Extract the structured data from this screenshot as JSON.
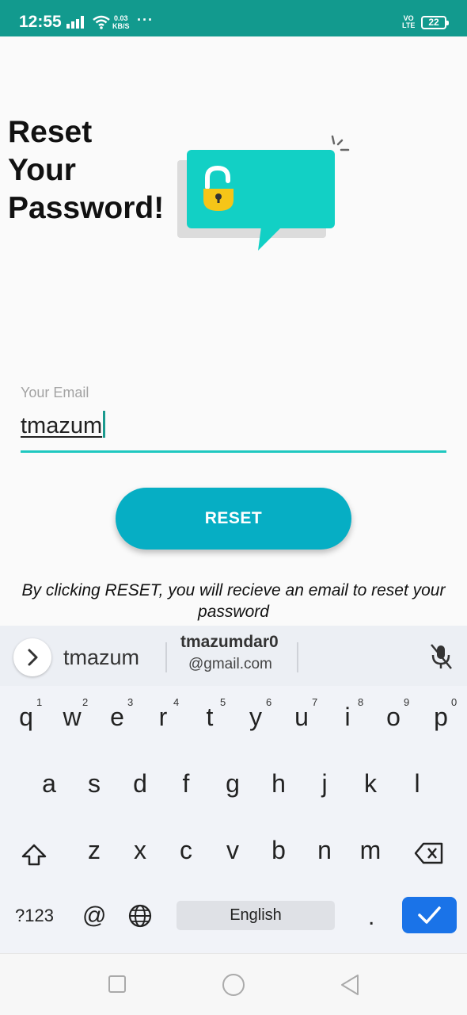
{
  "status_bar": {
    "time": "12:55",
    "net_speed_value": "0.03",
    "net_speed_unit": "KB/S",
    "more": "···",
    "volte_top": "VO",
    "volte_bottom": "LTE",
    "battery": "22",
    "background_color": "#129a8e"
  },
  "page": {
    "title_line1": "Reset",
    "title_line2": "Your",
    "title_line3": "Password!",
    "illustration_icon": "unlocked-padlock-speech-bubble",
    "accent_color": "#12d0c5"
  },
  "email_field": {
    "label": "Your Email",
    "value": "tmazum"
  },
  "reset_button": {
    "label": "RESET",
    "color": "#06aec4"
  },
  "info_text": "By clicking RESET, you will recieve an email to reset your password",
  "keyboard": {
    "suggestions": {
      "first": "tmazum",
      "second_line1": "tmazumdar0",
      "second_line2": "@gmail.com"
    },
    "row1": [
      {
        "k": "q",
        "h": "1"
      },
      {
        "k": "w",
        "h": "2"
      },
      {
        "k": "e",
        "h": "3"
      },
      {
        "k": "r",
        "h": "4"
      },
      {
        "k": "t",
        "h": "5"
      },
      {
        "k": "y",
        "h": "6"
      },
      {
        "k": "u",
        "h": "7"
      },
      {
        "k": "i",
        "h": "8"
      },
      {
        "k": "o",
        "h": "9"
      },
      {
        "k": "p",
        "h": "0"
      }
    ],
    "row2": [
      "a",
      "s",
      "d",
      "f",
      "g",
      "h",
      "j",
      "k",
      "l"
    ],
    "row3": [
      "z",
      "x",
      "c",
      "v",
      "b",
      "n",
      "m"
    ],
    "symbols_key": "?123",
    "at_key": "@",
    "space_label": "English",
    "period_key": ".",
    "enter_color": "#1a73e8"
  }
}
